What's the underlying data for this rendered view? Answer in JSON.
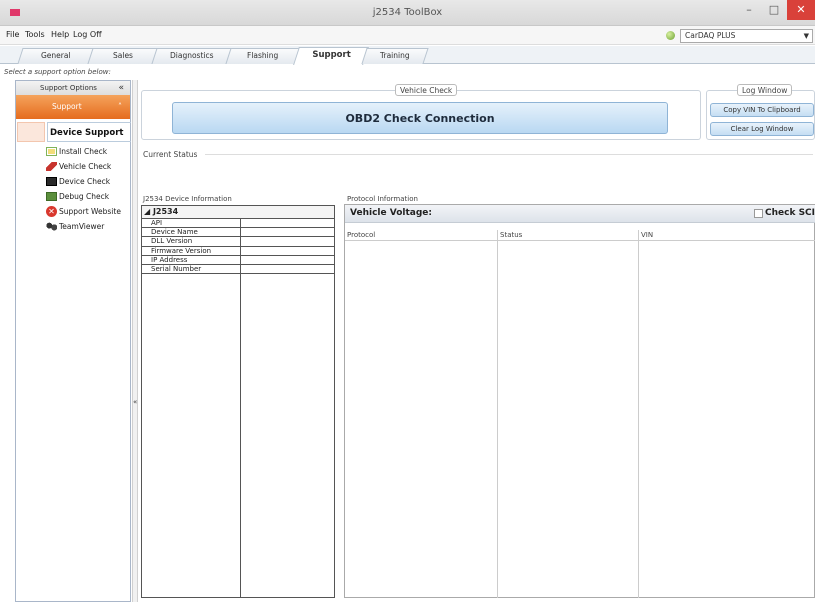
{
  "window": {
    "title": "j2534 ToolBox",
    "min": "–",
    "max": "□",
    "close": "✕"
  },
  "menu": [
    "File",
    "Tools",
    "Help",
    "Log Off"
  ],
  "device": {
    "selected": "CarDAQ PLUS",
    "status_color": "#6aa030"
  },
  "tabs": [
    {
      "label": "General",
      "active": false
    },
    {
      "label": "Sales",
      "active": false
    },
    {
      "label": "Diagnostics",
      "active": false
    },
    {
      "label": "Flashing",
      "active": false
    },
    {
      "label": "Support",
      "active": true
    },
    {
      "label": "Training",
      "active": false
    }
  ],
  "hint": "Select a support option below:",
  "sidebar": {
    "header": "Support Options",
    "header_chevron": "«",
    "group": "Support",
    "group_chevron": "˄",
    "selected": "Device Support",
    "items": [
      {
        "label": "Install Check",
        "icon": "install-check-icon"
      },
      {
        "label": "Vehicle Check",
        "icon": "vehicle-check-icon"
      },
      {
        "label": "Device Check",
        "icon": "device-check-icon"
      },
      {
        "label": "Debug Check",
        "icon": "debug-check-icon"
      },
      {
        "label": "Support Website",
        "icon": "support-website-icon"
      },
      {
        "label": "TeamViewer",
        "icon": "teamviewer-icon"
      }
    ]
  },
  "vehicle_check": {
    "legend": "Vehicle Check",
    "button": "OBD2 Check Connection"
  },
  "log_window": {
    "legend": "Log Window",
    "copy_vin": "Copy VIN To Clipboard",
    "clear": "Clear Log Window"
  },
  "current_status": {
    "label": "Current Status"
  },
  "device_info": {
    "label": "J2534 Device Information",
    "root": "◢ J2534",
    "rows": [
      "API",
      "Device Name",
      "DLL Version",
      "Firmware Version",
      "IP Address",
      "Serial Number"
    ]
  },
  "protocol_info": {
    "label": "Protocol Information",
    "voltage_label": "Vehicle Voltage:",
    "check_sci": "Check SCI",
    "columns": [
      "Protocol",
      "Status",
      "VIN"
    ]
  },
  "colors": {
    "accent_orange": "#e56c1e",
    "button_blue": "#b9d8f2",
    "close_red": "#d9413a"
  }
}
